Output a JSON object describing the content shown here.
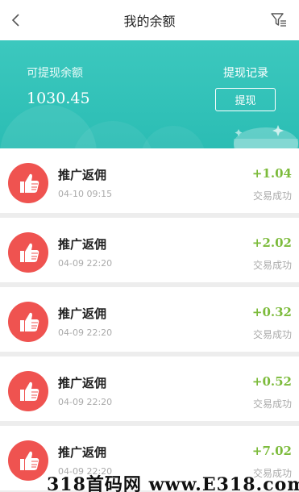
{
  "nav": {
    "title": "我的余额"
  },
  "balance": {
    "label": "可提现余额",
    "amount": "1030.45",
    "records_label": "提现记录",
    "withdraw_label": "提现"
  },
  "transactions": [
    {
      "title": "推广返佣",
      "time": "04-10 09:15",
      "amount": "+1.04",
      "status": "交易成功"
    },
    {
      "title": "推广返佣",
      "time": "04-09 22:20",
      "amount": "+2.02",
      "status": "交易成功"
    },
    {
      "title": "推广返佣",
      "time": "04-09 22:20",
      "amount": "+0.32",
      "status": "交易成功"
    },
    {
      "title": "推广返佣",
      "time": "04-09 22:20",
      "amount": "+0.52",
      "status": "交易成功"
    },
    {
      "title": "推广返佣",
      "time": "04-09 22:20",
      "amount": "+7.02",
      "status": "交易成功"
    }
  ],
  "watermark": "318首码网 www.E318.com",
  "colors": {
    "teal": "#2bbdb4",
    "red": "#ef5350",
    "green": "#7cbb3b"
  },
  "icons": {
    "back": "chevron-left-icon",
    "filter": "filter-icon",
    "thumb": "thumbs-up-icon"
  }
}
